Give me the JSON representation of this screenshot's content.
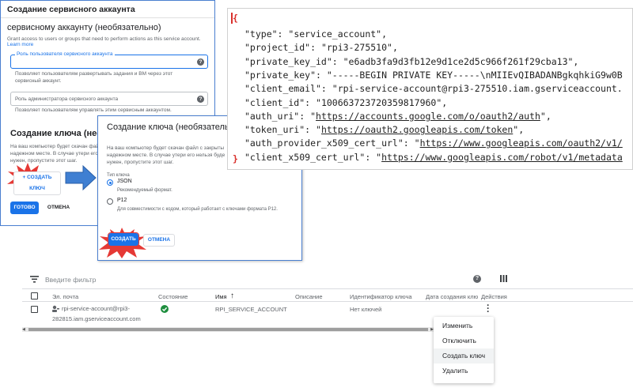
{
  "sa_dialog": {
    "header": "Создание сервисного аккаунта",
    "title": "сервисному аккаунту (необязательно)",
    "desc": "Grant access to users or groups that need to perform actions as this service account.",
    "learn_more": "Learn more",
    "field1_label": "Роль пользователя сервисного аккаунта",
    "field1_help": "Позволяет пользователям развертывать задания и ВМ через этот сервисный аккаунт.",
    "field2_placeholder": "Роль администратора сервисного аккаунта",
    "field2_help": "Позволяет пользователям управлять этим сервисным аккаунтом.",
    "key_title": "Создание ключа (необязательно)",
    "key_desc_1": "На ваш компьютер будет скачан файл с",
    "key_desc_2": "надежном месте. В случае утери его н",
    "key_desc_3": "нужен, пропустите этот шаг.",
    "create_key_btn": "+ СОЗДАТЬ КЛЮЧ",
    "done_btn": "ГОТОВО",
    "cancel_btn": "ОТМЕНА"
  },
  "key_dialog": {
    "title": "Создание ключа (необязательно)",
    "desc_1": "На ваш компьютер будет скачан файл с закрыты",
    "desc_2": "надежном месте. В случае утери его нельзя буде",
    "desc_3": "нужен, пропустите этот шаг.",
    "key_type_label": "Тип ключа",
    "json_label": "JSON",
    "json_hint": "Рекомендуемый формат.",
    "p12_label": "P12",
    "p12_hint": "Для совместимости с кодом, который работает с ключами формата P12.",
    "create_btn": "СОЗДАТЬ",
    "cancel_btn": "ОТМЕНА"
  },
  "json_file": {
    "open": "{",
    "close": "}",
    "lines": [
      {
        "k": "\"type\": ",
        "v": "\"service_account\",",
        "link": false
      },
      {
        "k": "\"project_id\": ",
        "v": "\"rpi3-275510\",",
        "link": false
      },
      {
        "k": "\"private_key_id\": ",
        "v": "\"e6adb3fa9d3fb12e9d1ce2d5c966f261f29cba13\",",
        "link": false
      },
      {
        "k": "\"private_key\": ",
        "v": "\"-----BEGIN PRIVATE KEY-----\\nMIIEvQIBADANBgkqhkiG9w0B",
        "link": false
      },
      {
        "k": "\"client_email\": ",
        "v": "\"rpi-service-account@rpi3-275510.iam.gserviceaccount.",
        "link": false
      },
      {
        "k": "\"client_id\": ",
        "v": "\"100663723720359817960\",",
        "link": false
      },
      {
        "k": "\"auth_uri\": ",
        "v": "\"https://accounts.google.com/o/oauth2/auth\",",
        "link": true
      },
      {
        "k": "\"token_uri\": ",
        "v": "\"https://oauth2.googleapis.com/token\",",
        "link": true
      },
      {
        "k": "\"auth_provider_x509_cert_url\": ",
        "v": "\"https://www.googleapis.com/oauth2/v1/",
        "link": true
      },
      {
        "k": "\"client_x509_cert_url\": ",
        "v": "\"https://www.googleapis.com/robot/v1/metadata",
        "link": true
      }
    ]
  },
  "accounts_table": {
    "filter_placeholder": "Введите фильтр",
    "columns": [
      "Эл. почта",
      "Состояние",
      "Имя",
      "Описание",
      "Идентификатор ключа",
      "Дата создания клю",
      "Действия"
    ],
    "row": {
      "email_1": "rpi-service-account@rpi3-",
      "email_2": "282815.iam.gserviceaccount.com",
      "name": "RPI_SERVICE_ACCOUNT",
      "key_id": "Нет ключей"
    },
    "menu": [
      "Изменить",
      "Отключить",
      "Создать ключ",
      "Удалить"
    ]
  },
  "colors": {
    "accent": "#1a73e8",
    "annotation_border": "#4a7fd0",
    "burst": "#e53935",
    "arrow": "#3f7fd2",
    "json_brace": "#d9302c"
  }
}
